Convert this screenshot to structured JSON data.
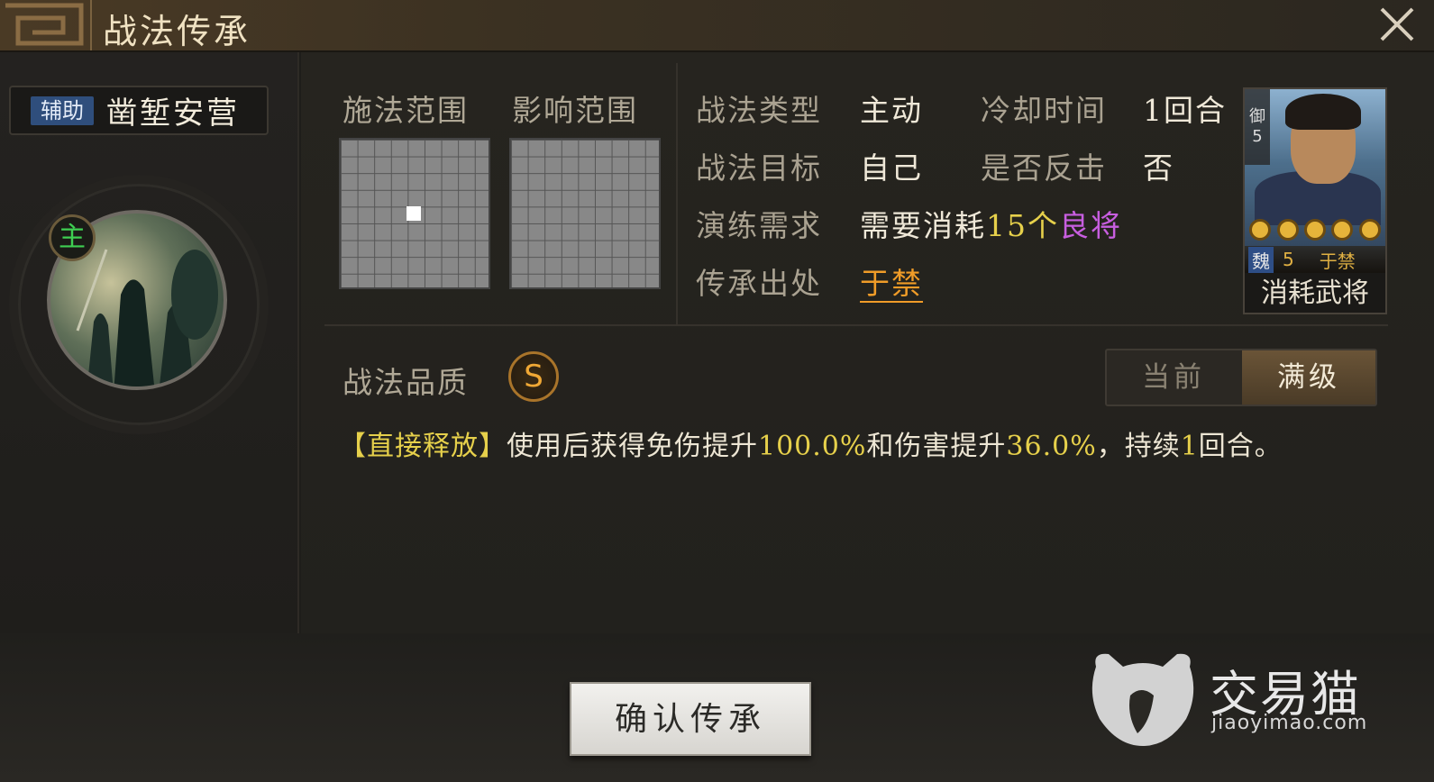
{
  "window": {
    "title": "战法传承",
    "close_icon": "close-icon"
  },
  "skill": {
    "type_tag": "辅助",
    "name": "凿堑安营",
    "main_badge": "主"
  },
  "ranges": {
    "cast_label": "施法范围",
    "effect_label": "影响范围"
  },
  "info": {
    "type_label": "战法类型",
    "type_value": "主动",
    "cooldown_label": "冷却时间",
    "cooldown_value": "1回合",
    "target_label": "战法目标",
    "target_value": "自己",
    "counter_label": "是否反击",
    "counter_value": "否",
    "training_label": "演练需求",
    "training_prefix": "需要消耗",
    "training_count": "15个",
    "training_quality": "良将",
    "source_label": "传承出处",
    "source_value": "于禁"
  },
  "general_card": {
    "rank_tag_char": "御",
    "rank_tag_num": "5",
    "stars": 5,
    "faction": "魏",
    "level": "5",
    "name": "于禁",
    "consume_label": "消耗武将"
  },
  "quality": {
    "label": "战法品质",
    "grade": "S"
  },
  "level_toggle": {
    "current_label": "当前",
    "max_label": "满级",
    "selected": "满级"
  },
  "description": {
    "tag": "【直接释放】",
    "part1": "使用后获得免伤提升",
    "value1": "100.0%",
    "part2": "和伤害提升",
    "value2": "36.0%",
    "part3": "，持续",
    "value3": "1",
    "part4": "回合。"
  },
  "actions": {
    "confirm_label": "确认传承"
  },
  "watermark": {
    "brand": "交易猫",
    "url": "jiaoyimao.com"
  },
  "colors": {
    "yellow_value": "#e6d04b",
    "purple_quality": "#c85ee0",
    "orange_link": "#f09c28",
    "green_main": "#3fcf52",
    "support_tag": "#2f4e7c"
  }
}
